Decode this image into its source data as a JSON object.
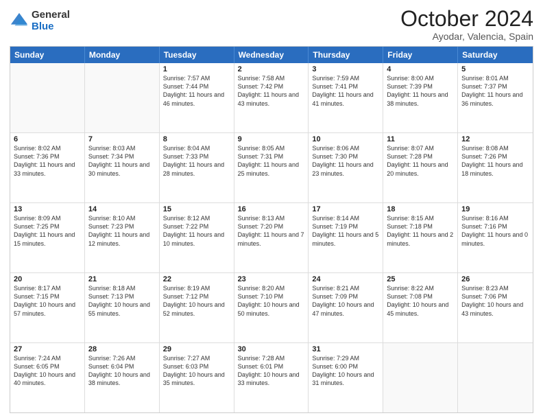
{
  "header": {
    "logo_general": "General",
    "logo_blue": "Blue",
    "title_month": "October 2024",
    "title_location": "Ayodar, Valencia, Spain"
  },
  "calendar": {
    "days_of_week": [
      "Sunday",
      "Monday",
      "Tuesday",
      "Wednesday",
      "Thursday",
      "Friday",
      "Saturday"
    ],
    "weeks": [
      [
        {
          "day": "",
          "content": ""
        },
        {
          "day": "",
          "content": ""
        },
        {
          "day": "1",
          "content": "Sunrise: 7:57 AM\nSunset: 7:44 PM\nDaylight: 11 hours and 46 minutes."
        },
        {
          "day": "2",
          "content": "Sunrise: 7:58 AM\nSunset: 7:42 PM\nDaylight: 11 hours and 43 minutes."
        },
        {
          "day": "3",
          "content": "Sunrise: 7:59 AM\nSunset: 7:41 PM\nDaylight: 11 hours and 41 minutes."
        },
        {
          "day": "4",
          "content": "Sunrise: 8:00 AM\nSunset: 7:39 PM\nDaylight: 11 hours and 38 minutes."
        },
        {
          "day": "5",
          "content": "Sunrise: 8:01 AM\nSunset: 7:37 PM\nDaylight: 11 hours and 36 minutes."
        }
      ],
      [
        {
          "day": "6",
          "content": "Sunrise: 8:02 AM\nSunset: 7:36 PM\nDaylight: 11 hours and 33 minutes."
        },
        {
          "day": "7",
          "content": "Sunrise: 8:03 AM\nSunset: 7:34 PM\nDaylight: 11 hours and 30 minutes."
        },
        {
          "day": "8",
          "content": "Sunrise: 8:04 AM\nSunset: 7:33 PM\nDaylight: 11 hours and 28 minutes."
        },
        {
          "day": "9",
          "content": "Sunrise: 8:05 AM\nSunset: 7:31 PM\nDaylight: 11 hours and 25 minutes."
        },
        {
          "day": "10",
          "content": "Sunrise: 8:06 AM\nSunset: 7:30 PM\nDaylight: 11 hours and 23 minutes."
        },
        {
          "day": "11",
          "content": "Sunrise: 8:07 AM\nSunset: 7:28 PM\nDaylight: 11 hours and 20 minutes."
        },
        {
          "day": "12",
          "content": "Sunrise: 8:08 AM\nSunset: 7:26 PM\nDaylight: 11 hours and 18 minutes."
        }
      ],
      [
        {
          "day": "13",
          "content": "Sunrise: 8:09 AM\nSunset: 7:25 PM\nDaylight: 11 hours and 15 minutes."
        },
        {
          "day": "14",
          "content": "Sunrise: 8:10 AM\nSunset: 7:23 PM\nDaylight: 11 hours and 12 minutes."
        },
        {
          "day": "15",
          "content": "Sunrise: 8:12 AM\nSunset: 7:22 PM\nDaylight: 11 hours and 10 minutes."
        },
        {
          "day": "16",
          "content": "Sunrise: 8:13 AM\nSunset: 7:20 PM\nDaylight: 11 hours and 7 minutes."
        },
        {
          "day": "17",
          "content": "Sunrise: 8:14 AM\nSunset: 7:19 PM\nDaylight: 11 hours and 5 minutes."
        },
        {
          "day": "18",
          "content": "Sunrise: 8:15 AM\nSunset: 7:18 PM\nDaylight: 11 hours and 2 minutes."
        },
        {
          "day": "19",
          "content": "Sunrise: 8:16 AM\nSunset: 7:16 PM\nDaylight: 11 hours and 0 minutes."
        }
      ],
      [
        {
          "day": "20",
          "content": "Sunrise: 8:17 AM\nSunset: 7:15 PM\nDaylight: 10 hours and 57 minutes."
        },
        {
          "day": "21",
          "content": "Sunrise: 8:18 AM\nSunset: 7:13 PM\nDaylight: 10 hours and 55 minutes."
        },
        {
          "day": "22",
          "content": "Sunrise: 8:19 AM\nSunset: 7:12 PM\nDaylight: 10 hours and 52 minutes."
        },
        {
          "day": "23",
          "content": "Sunrise: 8:20 AM\nSunset: 7:10 PM\nDaylight: 10 hours and 50 minutes."
        },
        {
          "day": "24",
          "content": "Sunrise: 8:21 AM\nSunset: 7:09 PM\nDaylight: 10 hours and 47 minutes."
        },
        {
          "day": "25",
          "content": "Sunrise: 8:22 AM\nSunset: 7:08 PM\nDaylight: 10 hours and 45 minutes."
        },
        {
          "day": "26",
          "content": "Sunrise: 8:23 AM\nSunset: 7:06 PM\nDaylight: 10 hours and 43 minutes."
        }
      ],
      [
        {
          "day": "27",
          "content": "Sunrise: 7:24 AM\nSunset: 6:05 PM\nDaylight: 10 hours and 40 minutes."
        },
        {
          "day": "28",
          "content": "Sunrise: 7:26 AM\nSunset: 6:04 PM\nDaylight: 10 hours and 38 minutes."
        },
        {
          "day": "29",
          "content": "Sunrise: 7:27 AM\nSunset: 6:03 PM\nDaylight: 10 hours and 35 minutes."
        },
        {
          "day": "30",
          "content": "Sunrise: 7:28 AM\nSunset: 6:01 PM\nDaylight: 10 hours and 33 minutes."
        },
        {
          "day": "31",
          "content": "Sunrise: 7:29 AM\nSunset: 6:00 PM\nDaylight: 10 hours and 31 minutes."
        },
        {
          "day": "",
          "content": ""
        },
        {
          "day": "",
          "content": ""
        }
      ]
    ]
  }
}
